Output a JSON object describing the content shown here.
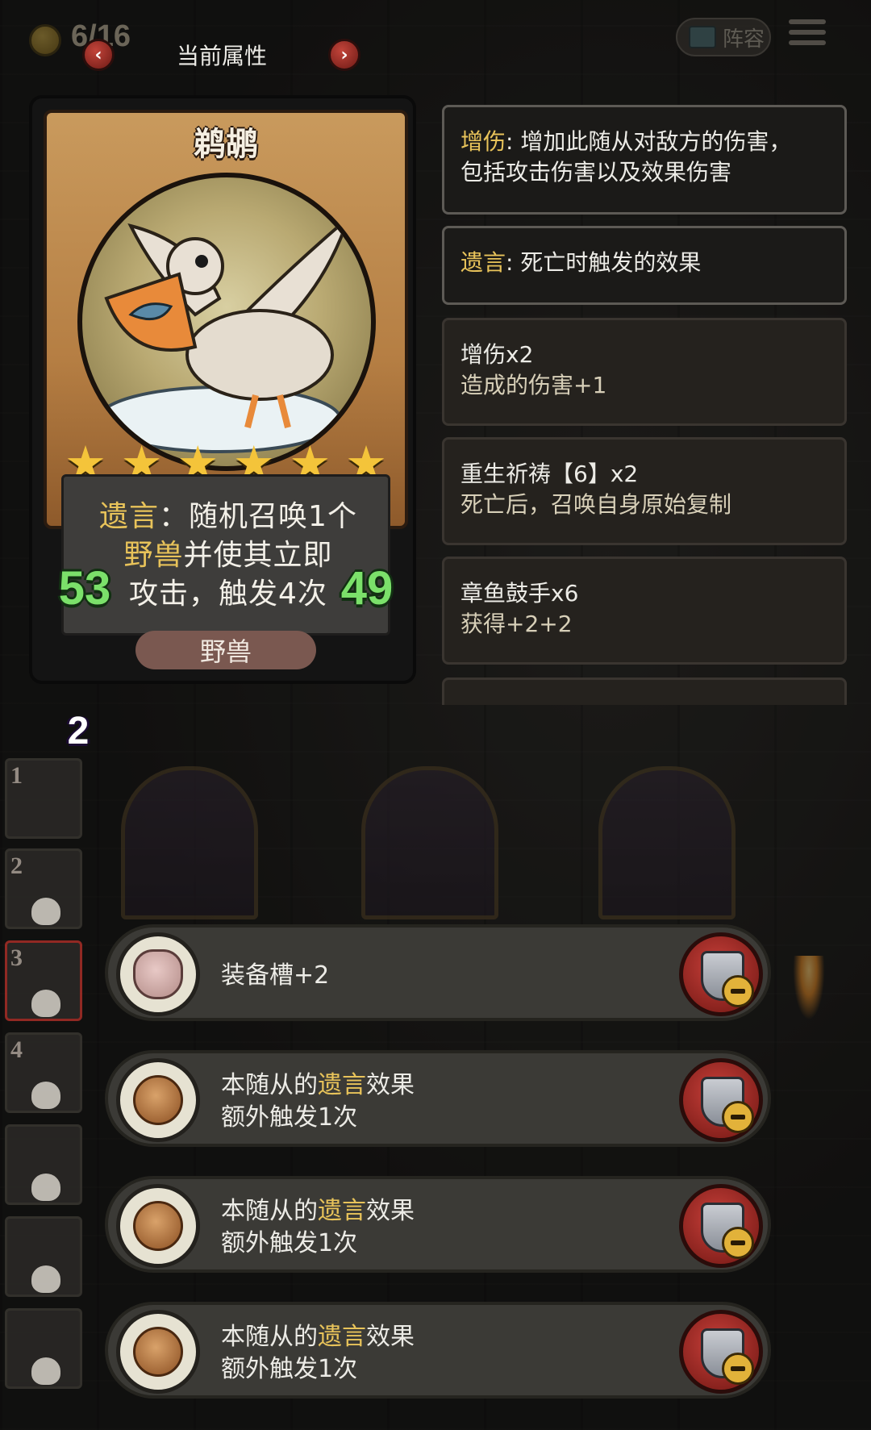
{
  "topbar": {
    "gold": "6/16",
    "attribute_title": "当前属性",
    "prev_label": "‹",
    "next_label": "›",
    "lineup_label": "阵容"
  },
  "card": {
    "name": "鹈鹕",
    "stars": 6,
    "star_glyphs": [
      "★",
      "★",
      "★",
      "★",
      "★",
      "★"
    ],
    "desc": {
      "l1_kw": "遗言",
      "l1_rest": "：随机召唤1个",
      "l2_kw": "野兽",
      "l2_rest": "并使其立即",
      "l3": "攻击，触发4次"
    },
    "attack": "53",
    "health": "49",
    "tribe": "野兽",
    "level": "2"
  },
  "info_panels": [
    {
      "kw": "增伤",
      "text": ": 增加此随从对敌方的伤害，",
      "text2": "包括攻击伤害以及效果伤害"
    },
    {
      "kw": "遗言",
      "text": ": 死亡时触发的效果"
    },
    {
      "title": "增伤x2",
      "sub": "造成的伤害+1"
    },
    {
      "title": "重生祈祷【6】x2",
      "sub": "死亡后，召唤自身原始复制"
    },
    {
      "title": "章鱼鼓手x6",
      "sub": "获得+2+2"
    }
  ],
  "slots": [
    "1",
    "2",
    "3",
    "4"
  ],
  "equipment": [
    {
      "icon": "pig-icon",
      "line1": "装备槽+2"
    },
    {
      "icon": "relic-coin-icon",
      "line1_pre": "本随从的",
      "line1_kw": "遗言",
      "line1_post": "效果",
      "line2": "额外触发1次"
    },
    {
      "icon": "relic-coin-icon",
      "line1_pre": "本随从的",
      "line1_kw": "遗言",
      "line1_post": "效果",
      "line2": "额外触发1次"
    },
    {
      "icon": "relic-coin-icon",
      "line1_pre": "本随从的",
      "line1_kw": "遗言",
      "line1_post": "效果",
      "line2": "额外触发1次"
    }
  ],
  "colors": {
    "keyword": "#e8c35a",
    "stat_green": "#7be06a",
    "remove_red": "#c8403a"
  }
}
